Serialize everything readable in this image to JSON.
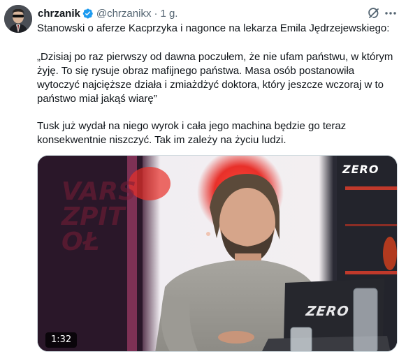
{
  "tweet": {
    "display_name": "chrzanik",
    "handle": "@chrzanikx",
    "separator": "·",
    "time": "1 g.",
    "text_line_1": "Stanowski o aferze Kacprzyka i nagonce na lekarza Emila Jędrzejewskiego:",
    "text_quote": "„Dzisiaj po raz pierwszy od dawna poczułem, że nie ufam państwu, w którym żyję. To się rysuje obraz mafijnego państwa. Masa osób postanowiła wytoczyć najcięższe działa i zmiażdżyć doktora, który jeszcze wczoraj w to państwo miał jakąś wiarę”",
    "text_line_3": "Tusk już wydał na niego wyrok i cała jego machina będzie go teraz konsekwentnie niszczyć. Tak im zależy na życiu ludzi."
  },
  "icons": {
    "verified": "verified-badge-icon",
    "grok": "grok-icon",
    "more": "more-options-icon"
  },
  "colors": {
    "verified_blue": "#1d9bf0",
    "secondary_text": "#536471",
    "studio_red": "#e0322e"
  },
  "media": {
    "duration": "1:32",
    "logo_corner": "ZERO",
    "logo_laptop": "ZERO",
    "wall_text": "VARS\nZPIT\nOŁ"
  }
}
